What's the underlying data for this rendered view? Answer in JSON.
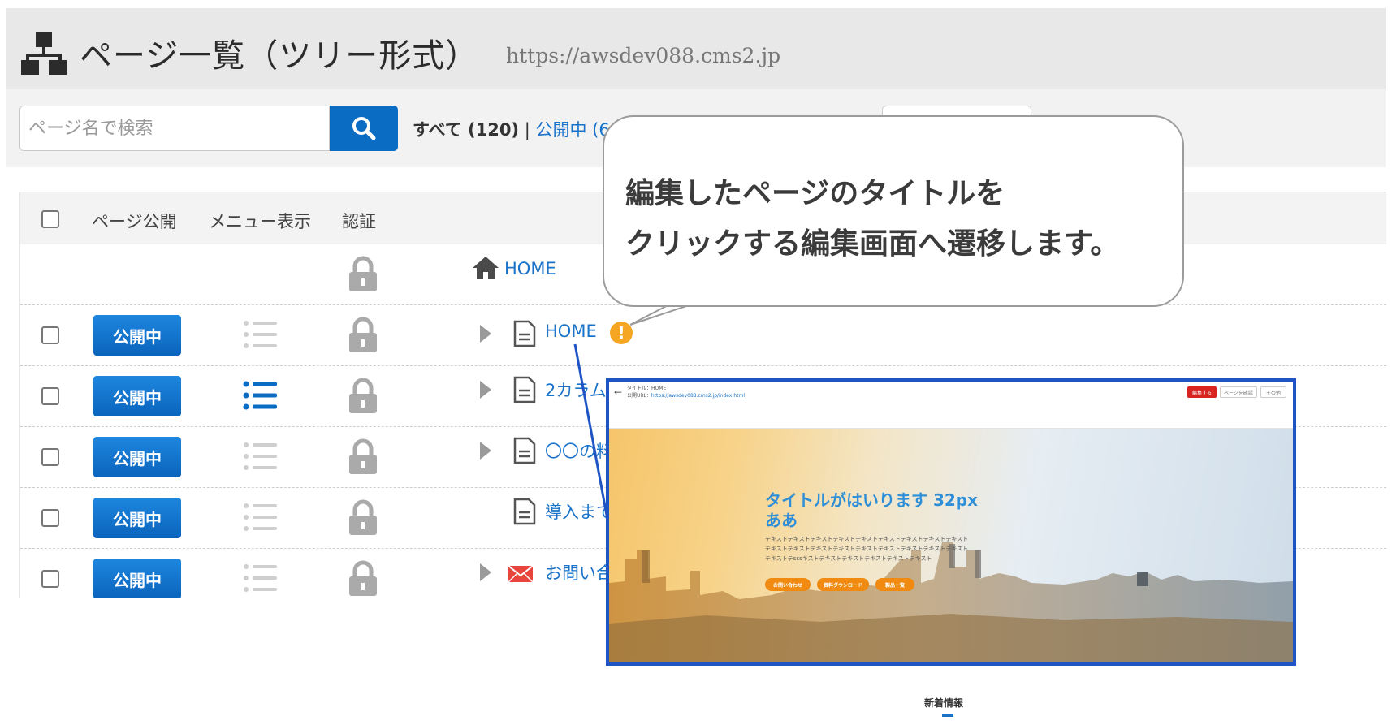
{
  "header": {
    "title": "ページ一覧（ツリー形式）",
    "url": "https://awsdev088.cms2.jp",
    "icon": "sitemap-icon"
  },
  "search": {
    "placeholder": "ページ名で検索",
    "button_icon": "search-icon",
    "filter_all": "すべて (120)",
    "filter_sep": " | ",
    "filter_published": "公開中 (6"
  },
  "table": {
    "columns": [
      "ページ公開",
      "メニュー表示",
      "認証"
    ],
    "rows": [
      {
        "type": "root",
        "title": "HOME",
        "icon": "home-icon",
        "published": false
      },
      {
        "type": "page",
        "publish_label": "公開中",
        "menu_active": false,
        "expand": true,
        "icon": "document-icon",
        "title": "HOME",
        "warning": "!"
      },
      {
        "type": "page",
        "publish_label": "公開中",
        "menu_active": true,
        "expand": true,
        "icon": "document-icon",
        "title": "2カラム"
      },
      {
        "type": "page",
        "publish_label": "公開中",
        "menu_active": false,
        "expand": true,
        "icon": "document-icon",
        "title": "〇〇の料"
      },
      {
        "type": "page",
        "publish_label": "公開中",
        "menu_active": false,
        "expand": false,
        "icon": "document-icon",
        "title": "導入まで"
      },
      {
        "type": "page",
        "publish_label": "公開中",
        "menu_active": false,
        "expand": true,
        "icon": "mail-icon",
        "title": "お問い合"
      }
    ]
  },
  "callout": {
    "line1": "編集したページのタイトルを",
    "line2": "クリックする編集画面へ遷移します。"
  },
  "preview": {
    "meta_title": "タイトル：HOME",
    "meta_url_label": "公開URL：",
    "meta_url": "https://awsdev088.cms2.jp/index.html",
    "btn_edit": "編集する",
    "btn_view": "ページを確認",
    "btn_other": "その他",
    "hero_title_1": "タイトルがはいります 32px",
    "hero_title_2": "ああ",
    "hero_body_1": "テキストテキストテキストテキストテキストテキストテキストテキストテキスト",
    "hero_body_2": "テキストテキストテキストテキストテキストテキストテキストテキストテキスト",
    "hero_body_3": "テキストテsssキストテキストテキストテキストテキストテキスト",
    "cta_1": "お問い合わせ",
    "cta_2": "資料ダウンロード",
    "cta_3": "製品一覧"
  },
  "footer": {
    "news": "新着情報"
  },
  "colors": {
    "primary": "#0b6cc4",
    "link": "#1a73c9",
    "warning": "#f5a623",
    "mail": "#e8453c",
    "frame": "#1f54c4",
    "cta": "#f08a10"
  }
}
